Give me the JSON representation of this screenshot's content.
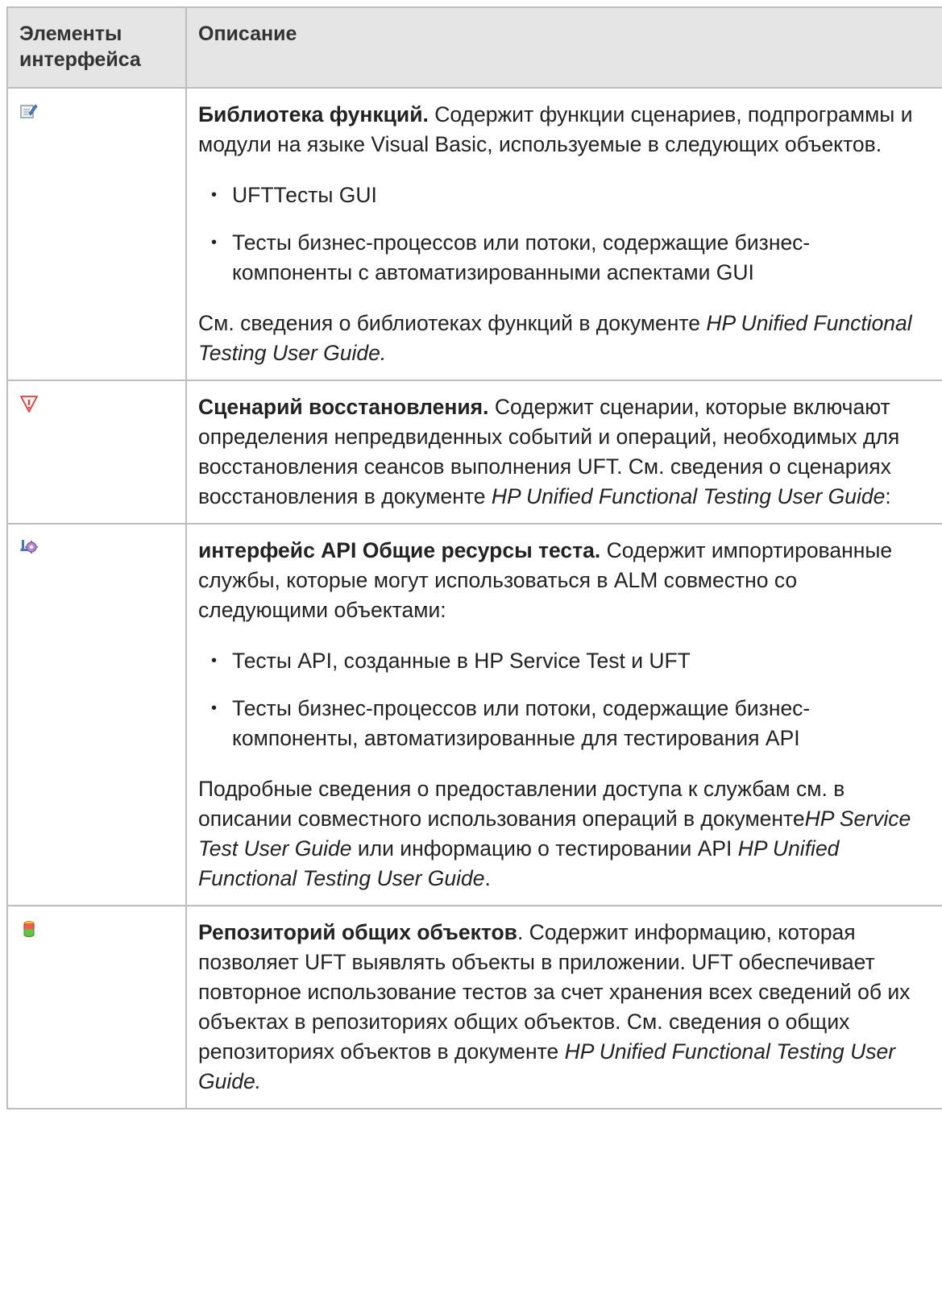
{
  "header": {
    "col1": "Элементы интерфейса",
    "col2": "Описание"
  },
  "rows": [
    {
      "icon": "function-library-icon",
      "title": "Библиотека функций.",
      "intro": " Содержит функции сценариев, подпрограммы и модули на языке Visual Basic, используемые в следующих объектов.",
      "bullets": [
        "UFTТесты GUI",
        "Тесты бизнес-процессов или потоки, содержащие бизнес-компоненты с автоматизированными аспектами GUI"
      ],
      "note_prefix": "См. сведения о библиотеках функций в документе ",
      "note_italic": "HP Unified Functional Testing User Guide.",
      "note_suffix": ""
    },
    {
      "icon": "recovery-scenario-icon",
      "title": "Сценарий восстановления.",
      "intro": " Содержит сценарии, которые включают определения непредвиденных событий и операций, необходимых для восстановления сеансов выполнения UFT. См. сведения о сценариях восстановления в документе ",
      "intro_italic": "HP Unified Functional Testing User Guide",
      "intro_suffix": ":"
    },
    {
      "icon": "api-test-resources-icon",
      "title": "интерфейс API Общие ресурсы теста.",
      "intro": " Содержит импортированные службы, которые могут использоваться в ALM совместно со следующими объектами:",
      "bullets": [
        "Тесты API, созданные в HP Service Test и UFT",
        "Тесты бизнес-процессов или потоки, содержащие бизнес-компоненты, автоматизированные для тестирования API"
      ],
      "note_prefix": "Подробные сведения о предоставлении доступа к службам см. в описании совместного использования операций в документе",
      "note_italic": "HP Service Test User Guide",
      "note_mid": " или информацию о тестировании API ",
      "note_italic2": "HP Unified Functional Testing User Guide",
      "note_suffix": "."
    },
    {
      "icon": "shared-object-repository-icon",
      "title": "Репозиторий общих объектов",
      "intro": ". Содержит информацию, которая позволяет UFT выявлять объекты в приложении. UFT обеспечивает повторное использование тестов за счет хранения всех сведений об их объектах в репозиториях общих объектов. См. сведения о общих репозиториях объектов в документе ",
      "intro_italic": "HP Unified Functional Testing User Guide."
    }
  ],
  "colors": {
    "header_bg": "#e5e5e5",
    "border": "#bdbdbd",
    "warning_red": "#e03a3a"
  }
}
